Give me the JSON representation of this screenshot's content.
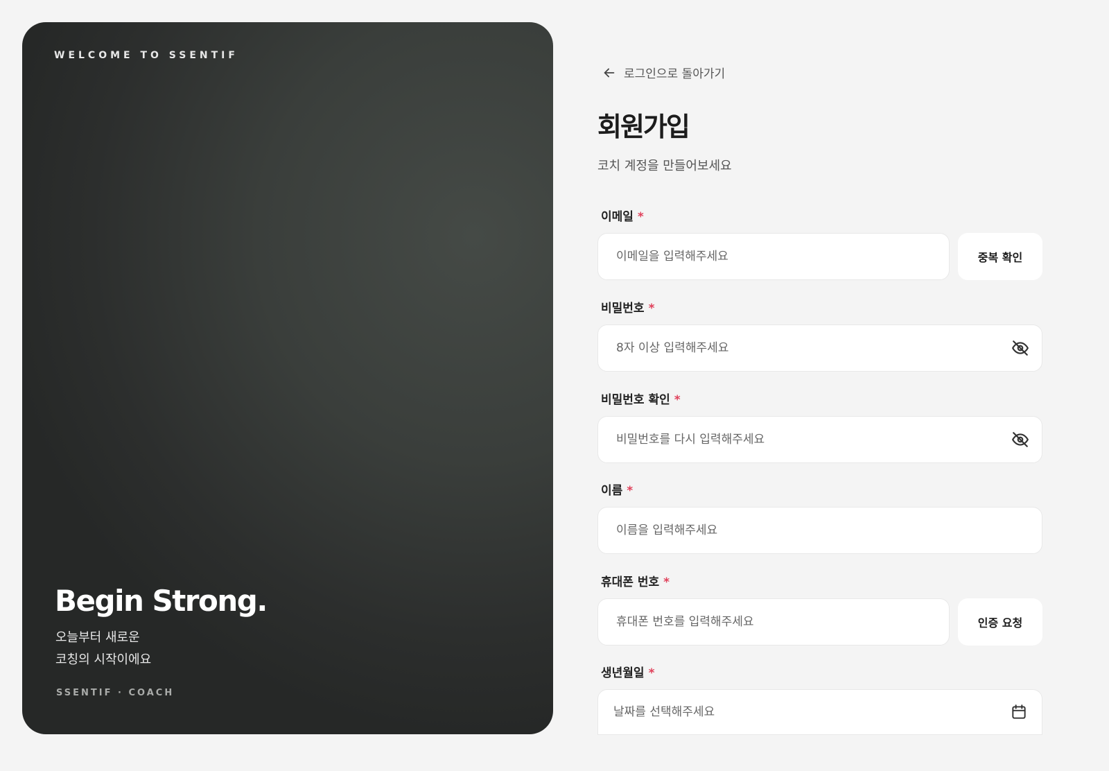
{
  "hero": {
    "eyebrow": "WELCOME TO SSENTIF",
    "headline": "Begin Strong.",
    "sub_line1": "오늘부터 새로운",
    "sub_line2": "코칭의 시작이에요",
    "footer": "SSENTIF · COACH"
  },
  "form": {
    "back_label": "로그인으로 돌아가기",
    "title": "회원가입",
    "subtitle": "코치 계정을 만들어보세요",
    "required_mark": "*",
    "fields": {
      "email": {
        "label": "이메일",
        "placeholder": "이메일을 입력해주세요",
        "button": "중복 확인"
      },
      "password": {
        "label": "비밀번호",
        "placeholder": "8자 이상 입력해주세요"
      },
      "password_confirm": {
        "label": "비밀번호 확인",
        "placeholder": "비밀번호를 다시 입력해주세요"
      },
      "name": {
        "label": "이름",
        "placeholder": "이름을 입력해주세요"
      },
      "phone": {
        "label": "휴대폰 번호",
        "placeholder": "휴대폰 번호를 입력해주세요",
        "button": "인증 요청"
      },
      "birthdate": {
        "label": "생년월일",
        "placeholder": "날짜를 선택해주세요"
      }
    }
  },
  "icons": {
    "back": "arrow-left-icon",
    "password_toggle": "eye-off-icon",
    "calendar": "calendar-icon"
  },
  "colors": {
    "background": "#f4f4f4",
    "required": "#e0405a",
    "hero_dark": "#2c2e2d"
  }
}
